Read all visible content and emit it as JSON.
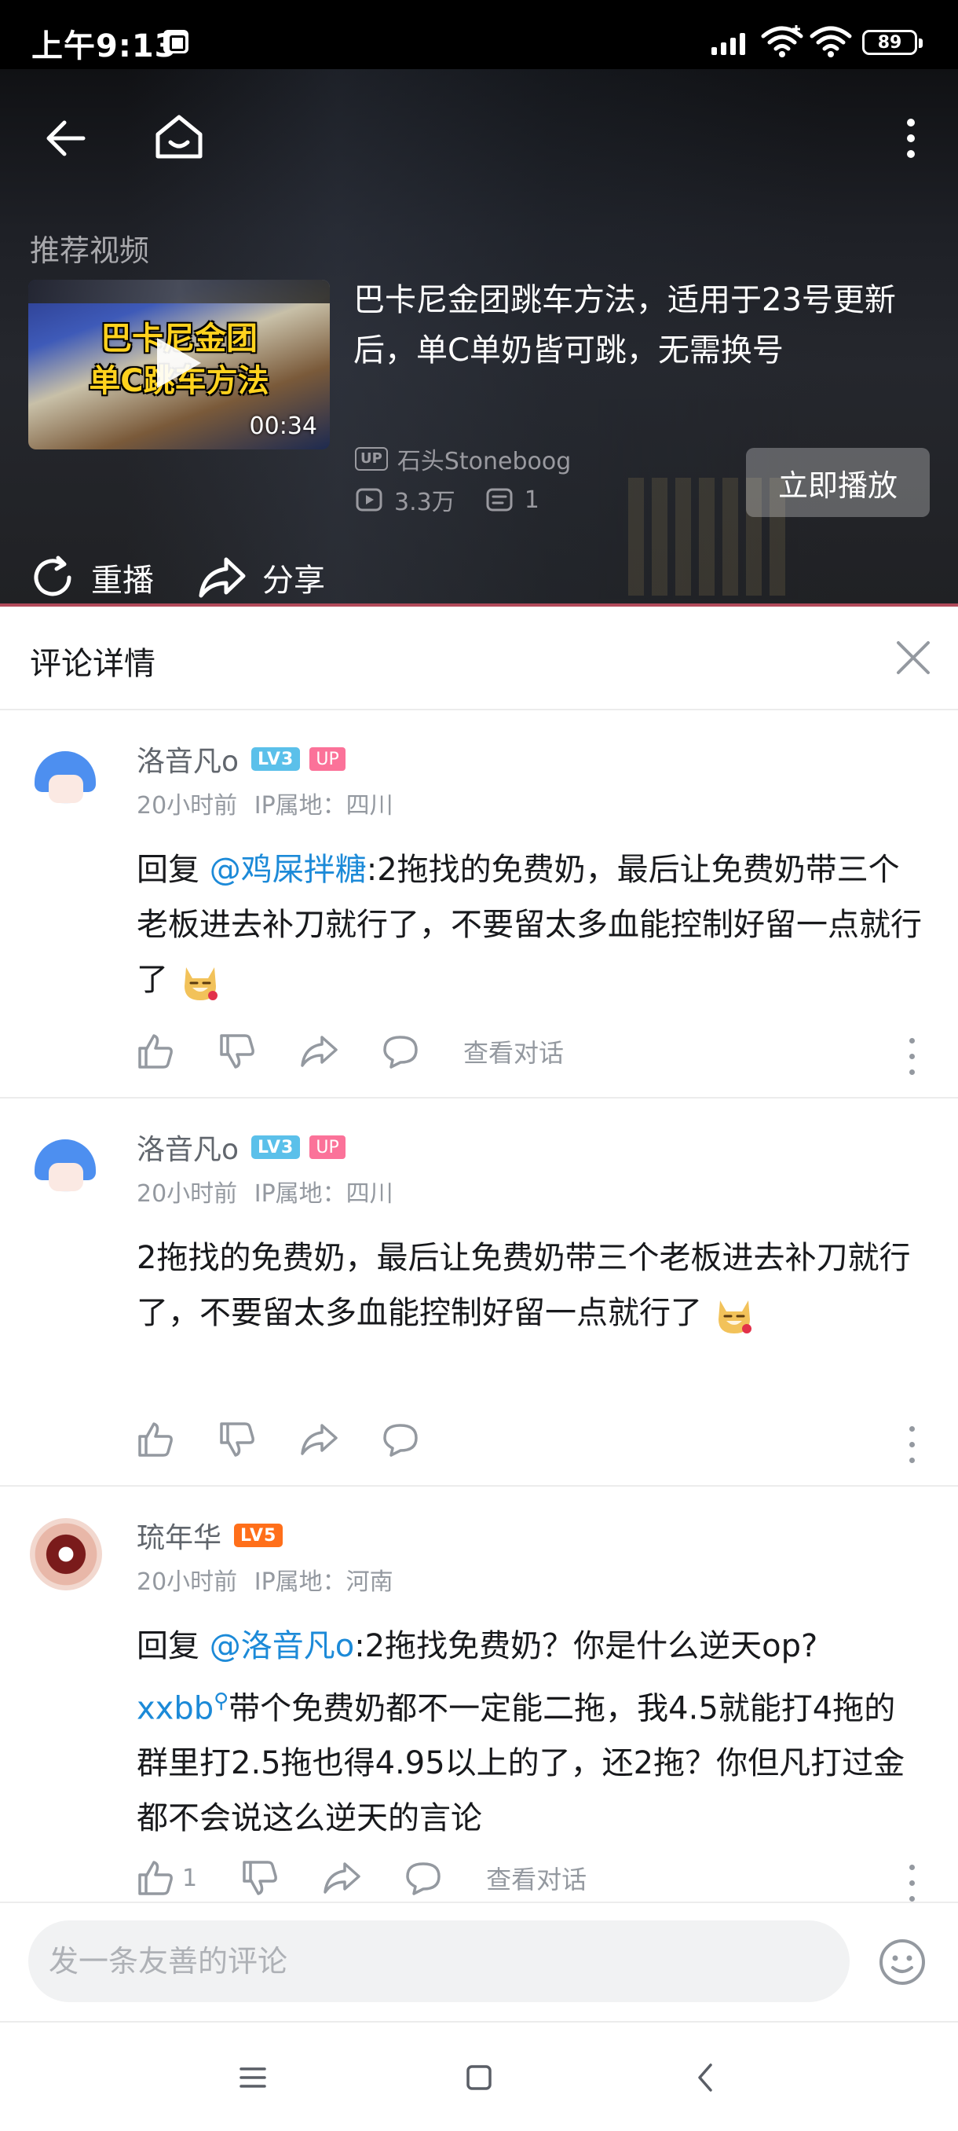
{
  "status_bar": {
    "time": "上午9:13",
    "battery": "89"
  },
  "video_panel": {
    "recommend_label": "推荐视频",
    "thumbnail_text": "巴卡尼金团\n单C跳车方法",
    "duration": "00:34",
    "title": "巴卡尼金团跳车方法，适用于23号更新后，单C单奶皆可跳，无需换号",
    "up_tag": "UP",
    "author": "石头Stoneboog",
    "views": "3.3万",
    "danmaku": "1",
    "play_now_label": "立即播放",
    "replay_label": "重播",
    "share_label": "分享"
  },
  "comment_detail": {
    "title": "评论详情"
  },
  "comments": [
    {
      "username": "洛音凡o",
      "level": "LV3",
      "level_color": "#5bc0ea",
      "up_badge": "UP",
      "time": "20小时前",
      "ip": "IP属地：四川",
      "reply_prefix": "回复",
      "mention": "@鸡屎拌糖",
      "text": ":2拖找的免费奶，最后让免费奶带三个老板进去补刀就行了，不要留太多血能控制好留一点就行了",
      "view_dialog": "查看对话"
    },
    {
      "username": "洛音凡o",
      "level": "LV3",
      "level_color": "#5bc0ea",
      "up_badge": "UP",
      "time": "20小时前",
      "ip": "IP属地：四川",
      "text": "2拖找的免费奶，最后让免费奶带三个老板进去补刀就行了，不要留太多血能控制好留一点就行了"
    },
    {
      "username": "琉年华",
      "level": "LV5",
      "level_color": "#ff6f1a",
      "time": "20小时前",
      "ip": "IP属地：河南",
      "reply_prefix": "回复",
      "mention": "@洛音凡o",
      "text_a": ":2拖找免费奶？你是什么逆天op?",
      "keyword": "xxbb",
      "text_b": "带个免费奶都不一定能二拖，我4.5就能打4拖的群里打2.5拖也得4.95以上的了，还2拖？你但凡打过金都不会说这么逆天的言论",
      "likes": "1",
      "view_dialog": "查看对话"
    }
  ],
  "input_bar": {
    "placeholder": "发一条友善的评论"
  },
  "colors": {
    "accent_blue": "#1c8ad8",
    "up_pink": "#fb7299",
    "secondary_text": "#9499a0"
  }
}
